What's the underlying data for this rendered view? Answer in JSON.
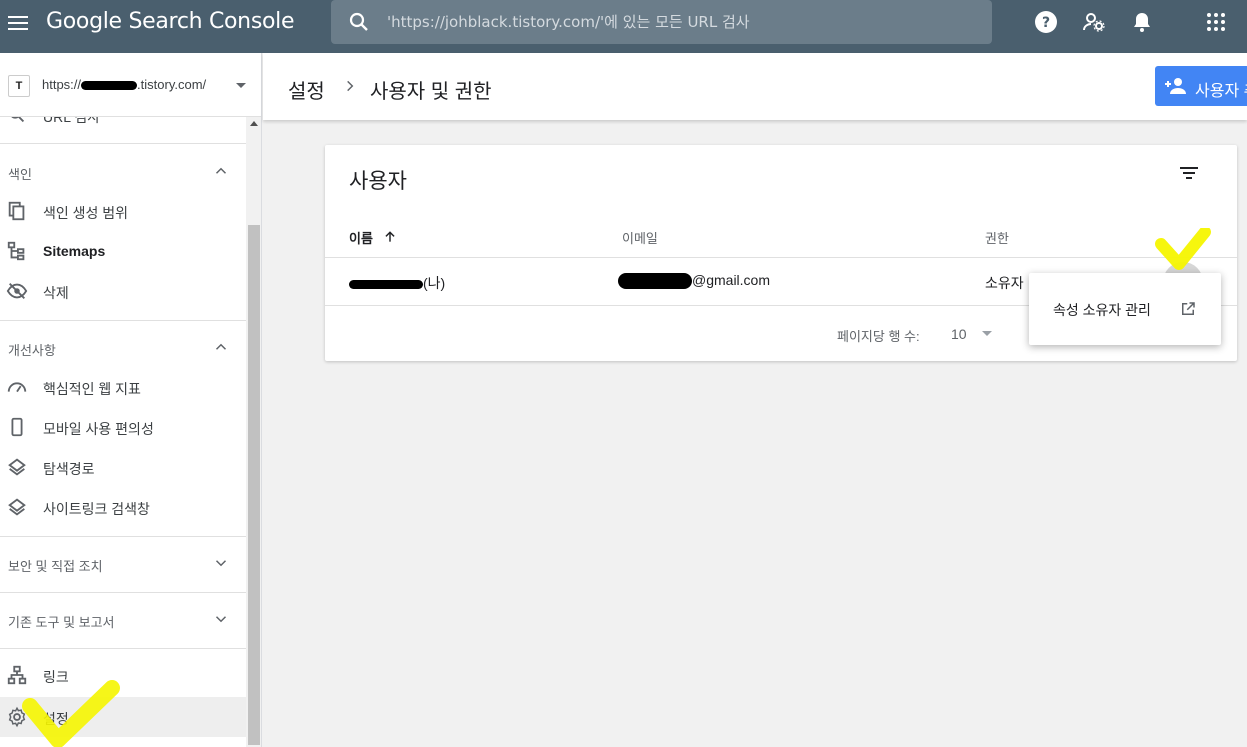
{
  "topbar": {
    "app_title": "Google Search Console",
    "search_placeholder": "'https://johblack.tistory.com/'에 있는 모든 URL 검사"
  },
  "sidebar": {
    "property_prefix": "https://",
    "property_suffix": ".tistory.com/",
    "partial_top_item": "URL 검사",
    "sections": [
      {
        "title": "색인",
        "expanded": true,
        "items": [
          {
            "label": "색인 생성 범위",
            "icon": "file-copy-icon"
          },
          {
            "label": "Sitemaps",
            "icon": "sitemap-icon"
          },
          {
            "label": "삭제",
            "icon": "eye-off-icon"
          }
        ]
      },
      {
        "title": "개선사항",
        "expanded": true,
        "items": [
          {
            "label": "핵심적인 웹 지표",
            "icon": "speedometer-icon"
          },
          {
            "label": "모바일 사용 편의성",
            "icon": "phone-icon"
          },
          {
            "label": "탐색경로",
            "icon": "layers-icon"
          },
          {
            "label": "사이트링크 검색창",
            "icon": "layers-icon"
          }
        ]
      },
      {
        "title": "보안 및 직접 조치",
        "expanded": false
      },
      {
        "title": "기존 도구 및 보고서",
        "expanded": false
      }
    ],
    "bottom_items": [
      {
        "label": "링크",
        "icon": "link-tree-icon"
      },
      {
        "label": "설정",
        "icon": "gear-icon",
        "active": true
      }
    ]
  },
  "header": {
    "breadcrumb_parent": "설정",
    "breadcrumb_current": "사용자 및 권한",
    "add_user_label": "사용자 추"
  },
  "card": {
    "title": "사용자",
    "columns": {
      "name": "이름",
      "email": "이메일",
      "permission": "권한"
    },
    "rows": [
      {
        "name_suffix": "(나)",
        "email_suffix": "@gmail.com",
        "permission": "소유자"
      }
    ],
    "pager_label": "페이지당 행 수:",
    "pager_value": "10"
  },
  "menu": {
    "item_label": "속성 소유자 관리"
  },
  "colors": {
    "topbar": "#4a5f6e",
    "accent": "#4285f4",
    "highlighter": "#f5f500"
  }
}
